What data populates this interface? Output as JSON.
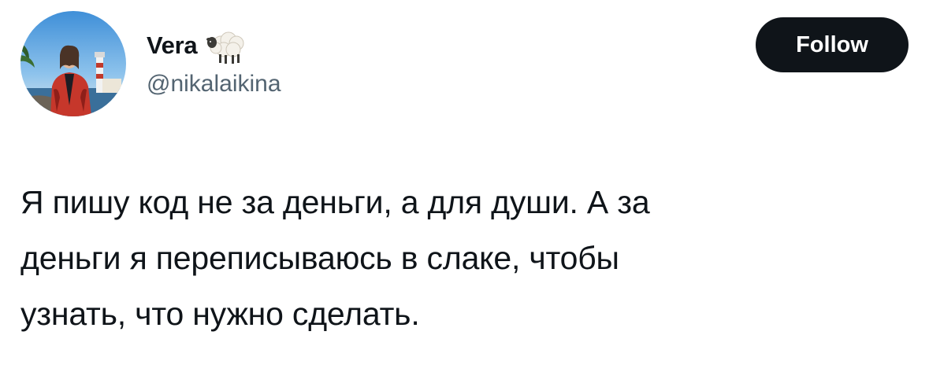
{
  "author": {
    "display_name": "Vera",
    "name_emoji": "sheep-emoji",
    "handle": "@nikalaikina",
    "avatar": "profile-photo"
  },
  "actions": {
    "follow_label": "Follow"
  },
  "tweet": {
    "text": "Я пишу код не за деньги, а для души. А за\nденьги я переписываюсь в слаке, чтобы\nузнать, что нужно сделать."
  },
  "colors": {
    "text_primary": "#0f1419",
    "text_secondary": "#536471",
    "follow_button_bg": "#0f1419",
    "follow_button_text": "#ffffff",
    "background": "#ffffff"
  }
}
